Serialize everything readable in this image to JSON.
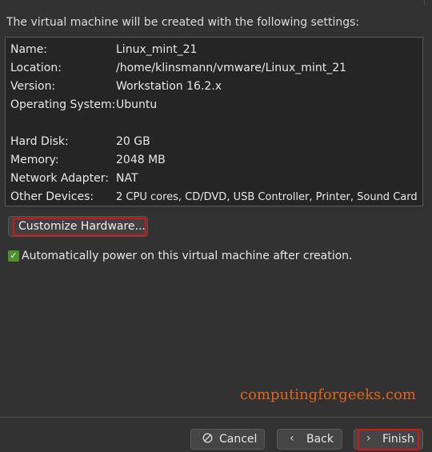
{
  "intro_text": "The virtual machine will be created with the following settings:",
  "settings": [
    {
      "key": "Name:",
      "value": "Linux_mint_21"
    },
    {
      "key": "Location:",
      "value": "/home/klinsmann/vmware/Linux_mint_21"
    },
    {
      "key": "Version:",
      "value": "Workstation 16.2.x"
    },
    {
      "key": "Operating System:",
      "value": "Ubuntu"
    },
    {
      "key": "Hard Disk:",
      "value": "20 GB"
    },
    {
      "key": "Memory:",
      "value": "2048 MB"
    },
    {
      "key": "Network Adapter:",
      "value": "NAT"
    },
    {
      "key": "Other Devices:",
      "value": "2 CPU cores, CD/DVD, USB Controller, Printer, Sound Card"
    }
  ],
  "customize_label": "Customize Hardware...",
  "power_on": {
    "checked": true,
    "label": "Automatically power on this virtual machine after creation."
  },
  "watermark": "computingforgeeks.com",
  "buttons": {
    "cancel": "Cancel",
    "back": "Back",
    "finish": "Finish"
  },
  "colors": {
    "highlight": "#d01818",
    "checkbox": "#4e8f2e",
    "watermark": "#e0651f"
  }
}
